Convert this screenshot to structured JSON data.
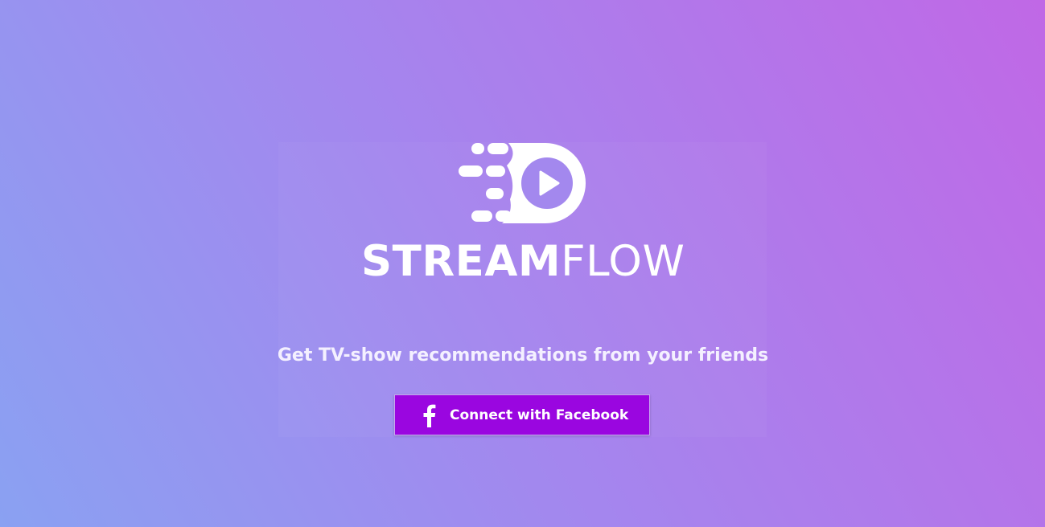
{
  "brand": {
    "name_bold": "STREAM",
    "name_light": "FLOW",
    "logo_icon": "play-motion-logo-icon"
  },
  "tagline": "Get TV-show recommendations from your friends",
  "login": {
    "button_label": "Connect with Facebook",
    "button_icon": "facebook-icon",
    "button_color": "#9a06e0"
  },
  "colors": {
    "background_start": "#8aa1f2",
    "background_end": "#c068e6",
    "text": "#ffffff"
  }
}
